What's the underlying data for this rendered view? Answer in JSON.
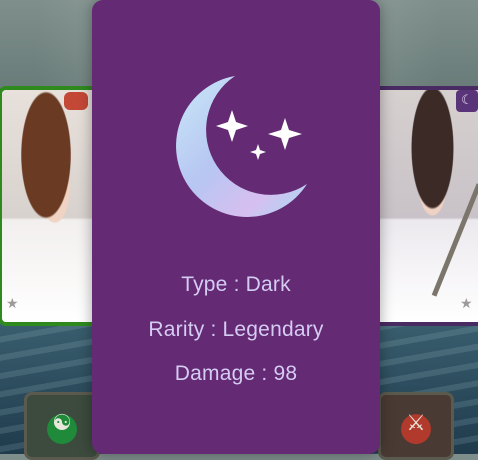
{
  "card": {
    "element_icon": "crescent-moon-stars-icon",
    "type_label": "Type",
    "type_value": "Dark",
    "rarity_label": "Rarity",
    "rarity_value": "Legendary",
    "damage_label": "Damage",
    "damage_value": "98",
    "separator": " : ",
    "colors": {
      "card_background": "#642a74",
      "text": "#d5ccf2"
    }
  },
  "background_cards": [
    {
      "position": "left",
      "border_color": "#2f8a1e",
      "badge_icon": "star-icon"
    },
    {
      "position": "right",
      "border_color": "#4a2a63",
      "badge_icon": "moon-icon",
      "corner_badge": "star-icon"
    }
  ],
  "bottom_buttons": [
    {
      "position": "left",
      "icon": "nature-element-icon"
    },
    {
      "position": "right",
      "icon": "crossed-swords-icon"
    }
  ]
}
